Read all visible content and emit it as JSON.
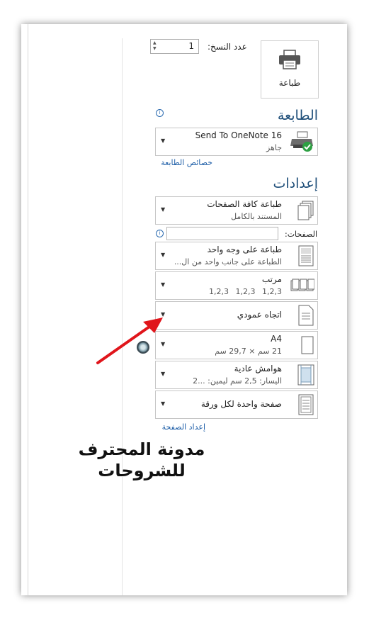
{
  "print_button": {
    "label": "طباعة"
  },
  "copies": {
    "label": "عدد النسخ:",
    "value": "1"
  },
  "printer_section": {
    "heading": "الطابعة",
    "printer_name": "Send To OneNote 16",
    "printer_status": "جاهز",
    "properties_link": "خصائص الطابعة"
  },
  "settings_section": {
    "heading": "إعدادات",
    "print_what": {
      "title": "طباعة كافة الصفحات",
      "subtitle": "المستند بالكامل"
    },
    "pages": {
      "label": "الصفحات:",
      "value": ""
    },
    "sides": {
      "title": "طباعة على وجه واحد",
      "subtitle": "الطباعة على جانب واحد من ال..."
    },
    "collate": {
      "title": "مرتب",
      "subtitle": "1,2,3    1,2,3    1,2,3"
    },
    "orientation": {
      "title": "اتجاه عمودي"
    },
    "paper": {
      "title": "A4",
      "subtitle": "21 سم × 29,7 سم"
    },
    "margins": {
      "title": "هوامش عادية",
      "subtitle": "اليسار: 2,5 سم    ليمين: ...2"
    },
    "pages_per_sheet": {
      "title": "صفحة واحدة لكل ورقة"
    },
    "page_setup_link": "إعداد الصفحة"
  },
  "watermark": {
    "line1": "مدونة المحترف",
    "line2": "للشروحات"
  },
  "colors": {
    "heading": "#1e4e79",
    "link": "#1f5fa8",
    "arrow": "#e0151b"
  },
  "icons": [
    "printer-icon",
    "info-icon",
    "pages-icon",
    "single-sided-icon",
    "collate-icon",
    "portrait-icon",
    "paper-size-icon",
    "margins-icon",
    "pages-per-sheet-icon",
    "dropdown-arrow-icon"
  ]
}
